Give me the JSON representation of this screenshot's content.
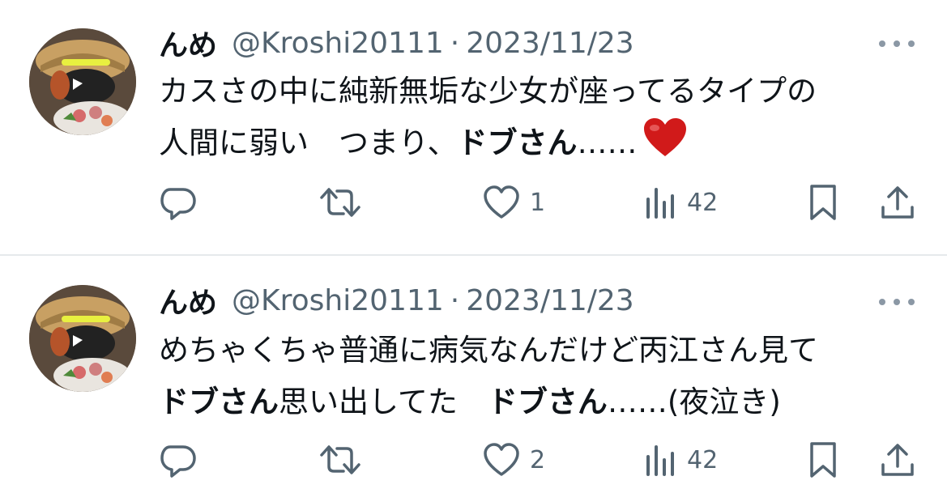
{
  "tweets": [
    {
      "author_name": "んめ",
      "handle": "@Kroshi20111",
      "separator": "·",
      "date": "2023/11/23",
      "body_lines": [
        [
          {
            "text": "カスさの中に純新無垢な少女が座ってるタイプの",
            "bold": false
          }
        ],
        [
          {
            "text": "人間に弱い　つまり、",
            "bold": false
          },
          {
            "text": "ドブさん",
            "bold": true
          },
          {
            "text": "……",
            "bold": false
          },
          {
            "emoji": "heart"
          }
        ]
      ],
      "likes": "1",
      "views": "42"
    },
    {
      "author_name": "んめ",
      "handle": "@Kroshi20111",
      "separator": "·",
      "date": "2023/11/23",
      "body_lines": [
        [
          {
            "text": "めちゃくちゃ普通に病気なんだけど丙江さん見て",
            "bold": false
          }
        ],
        [
          {
            "text": "ドブさん",
            "bold": true
          },
          {
            "text": "思い出してた　",
            "bold": false
          },
          {
            "text": "ドブさん",
            "bold": true
          },
          {
            "text": "……(夜泣き)",
            "bold": false
          }
        ]
      ],
      "likes": "2",
      "views": "42"
    }
  ],
  "icons": {
    "more": "more-horizontal-icon",
    "reply": "reply-icon",
    "retweet": "retweet-icon",
    "like": "like-heart-icon",
    "views": "views-chart-icon",
    "bookmark": "bookmark-icon",
    "share": "share-icon",
    "emoji": "red-heart-emoji"
  },
  "colors": {
    "text": "#0f1419",
    "secondary": "#536471",
    "divider": "#e6e9ec",
    "emoji_heart": "#d11a1a"
  }
}
